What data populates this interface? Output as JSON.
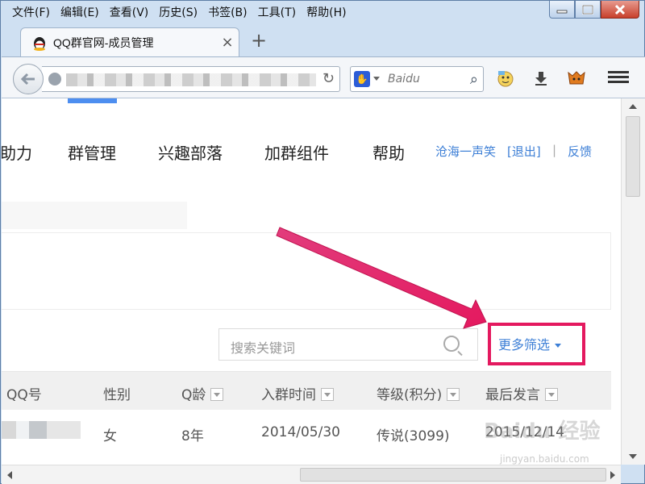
{
  "menubar": {
    "items": [
      "文件(F)",
      "编辑(E)",
      "查看(V)",
      "历史(S)",
      "书签(B)",
      "工具(T)",
      "帮助(H)"
    ]
  },
  "tab": {
    "title": "QQ群官网-成员管理",
    "close": "×"
  },
  "newtab": "+",
  "navbar": {
    "search_placeholder": "Baidu",
    "back": "←",
    "reload": "↻"
  },
  "site_nav": {
    "items": [
      "助力",
      "群管理",
      "兴趣部落",
      "加群组件",
      "帮助"
    ],
    "user": "沧海一声笑",
    "logout": "[退出]",
    "separator": "|",
    "feedback": "反馈"
  },
  "search": {
    "placeholder": "搜索关键词"
  },
  "filter": {
    "label": "更多筛选"
  },
  "table": {
    "headers": [
      "QQ号",
      "性别",
      "Q龄",
      "入群时间",
      "等级(积分)",
      "最后发言"
    ],
    "rows": [
      {
        "qq": "",
        "gender": "女",
        "q_age": "8年",
        "join_date": "2014/05/30",
        "level": "传说(3099)",
        "last_speak": "2015/12/14"
      }
    ]
  },
  "watermark": {
    "main": "Baidu 经验",
    "sub": "jingyan.baidu.com"
  },
  "colors": {
    "accent_blue": "#3d7fd6",
    "highlight": "#e4195f",
    "nav_strip": "#4d8ef0"
  }
}
